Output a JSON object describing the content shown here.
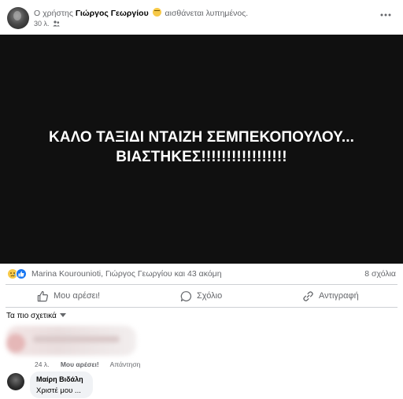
{
  "post": {
    "header": {
      "prefix": "Ο χρήστης",
      "author": "Γιώργος Γεωργίου",
      "feeling_icon": "sad-face-emoji",
      "feeling": "αισθάνεται λυπημένος.",
      "time": "30 λ.",
      "audience_icon": "friends-icon",
      "more_icon": "more-options-icon"
    },
    "image_text": {
      "line1": "ΚΑΛΟ ΤΑΞΙΔΙ ΝΤΑΙΖΗ ΣΕΜΠΕΚΟΠΟΥΛΟΥ...",
      "line2": "ΒΙΑΣΤΗΚΕΣ!!!!!!!!!!!!!!!!!"
    },
    "reactions": {
      "icons": [
        "sad-reaction",
        "like-reaction"
      ],
      "names": "Marina Kourounioti, Γιώργος Γεωργίου και 43 ακόμη",
      "comments": "8 σχόλια"
    },
    "actions": {
      "like": "Μου αρέσει!",
      "comment": "Σχόλιο",
      "copy": "Αντιγραφή"
    }
  },
  "comments": {
    "sort_label": "Τα πιο σχετικά",
    "first_comment_meta": {
      "time": "24 λ.",
      "like": "Μου αρέσει!",
      "reply": "Απάντηση"
    },
    "reply": {
      "author": "Μαίρη Βιδάλη",
      "text": "Χριστέ μου ..."
    }
  },
  "colors": {
    "accent": "#1877f2",
    "secondary_text": "#65676b",
    "image_background": "#101010"
  }
}
